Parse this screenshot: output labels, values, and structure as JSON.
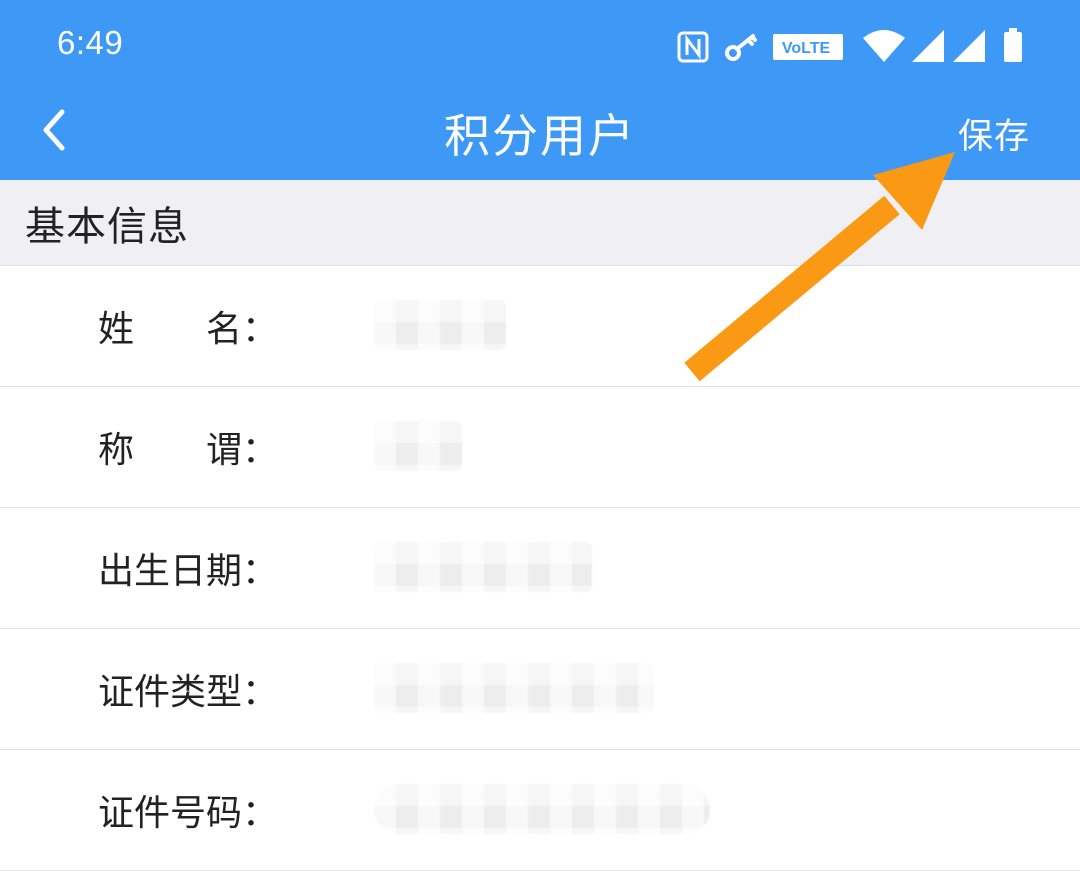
{
  "status_bar": {
    "time": "6:49",
    "volte_label": "VoLTE",
    "icons": [
      "nfc-icon",
      "vpn-key-icon",
      "volte-icon",
      "wifi-icon",
      "signal-icon",
      "signal-icon-2",
      "battery-icon"
    ]
  },
  "header": {
    "title": "积分用户",
    "save_label": "保存",
    "back_icon": "chevron-left-icon",
    "background_color": "#3d99f5"
  },
  "section": {
    "title": "基本信息"
  },
  "fields": [
    {
      "label": "姓　　名：",
      "value": ""
    },
    {
      "label": "称　　谓：",
      "value": ""
    },
    {
      "label": "出生日期：",
      "value": ""
    },
    {
      "label": "证件类型：",
      "value": ""
    },
    {
      "label": "证件号码：",
      "value": ""
    }
  ],
  "annotation": {
    "arrow_color": "#fa9a14",
    "points_to": "save-button"
  }
}
